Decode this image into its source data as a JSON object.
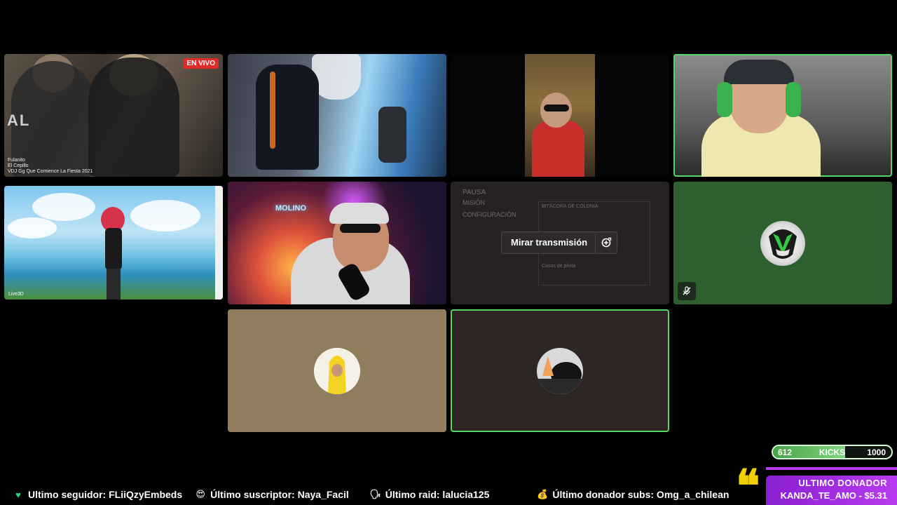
{
  "tiles": [
    {
      "id": "t1",
      "live_badge": "EN VIVO",
      "brand_text": "AL",
      "caption_lines": [
        "Fulanito",
        "El Cepillo",
        "VDJ Gg Que Comience La Fiesta 2021"
      ]
    },
    {
      "id": "t2"
    },
    {
      "id": "t3"
    },
    {
      "id": "t4",
      "active": true
    },
    {
      "id": "t5",
      "watermark": "Live3D"
    },
    {
      "id": "t6",
      "neon_sign": "MOLINO"
    },
    {
      "id": "t7",
      "paused": true,
      "ghost_title": "PAUSA",
      "ghost_sub1": "MISIÓN",
      "ghost_sub2": "CONFIGURACIÓN",
      "ghost_panel_title": "BITÁCORA DE COLONIA",
      "ghost_panel_text": "Casos de pilota",
      "watch_button": "Mirar transmisión",
      "popout_icon": "popout-icon"
    },
    {
      "id": "t8",
      "muted": true,
      "avatar_icon": "helmet-avatar"
    },
    {
      "id": "t9",
      "avatar_icon": "banana-avatar"
    },
    {
      "id": "t10",
      "active": true,
      "avatar_icon": "cat-avatar"
    }
  ],
  "kicks": {
    "current": "612",
    "label": "KICKS",
    "goal": "1000",
    "progress": 0.612
  },
  "ticker": [
    {
      "icon": "heart-icon",
      "glyph": "♥",
      "color": "#33d17a",
      "text": "Ultimo seguidor: FLiiQzyEmbeds"
    },
    {
      "icon": "heart-eyes-icon",
      "glyph": "😍",
      "color": "#ff5252",
      "text": "Último suscriptor: Naya_Facil"
    },
    {
      "icon": "speaking-head-icon",
      "glyph": "🗣",
      "color": "#ffffff",
      "text": "Último raid: lalucia125"
    },
    {
      "icon": "money-bag-icon",
      "glyph": "💰",
      "color": "#e0b84c",
      "text": "Último donador subs: Omg_a_chilean"
    }
  ],
  "donor": {
    "title": "ULTIMO DONADOR",
    "value": "KANDA_TE_AMO - $5.31",
    "quote_glyph": "❝"
  },
  "colors": {
    "accent_green": "#53d769",
    "donor_purple": "#b93bf0",
    "live_red": "#e02b2b"
  }
}
